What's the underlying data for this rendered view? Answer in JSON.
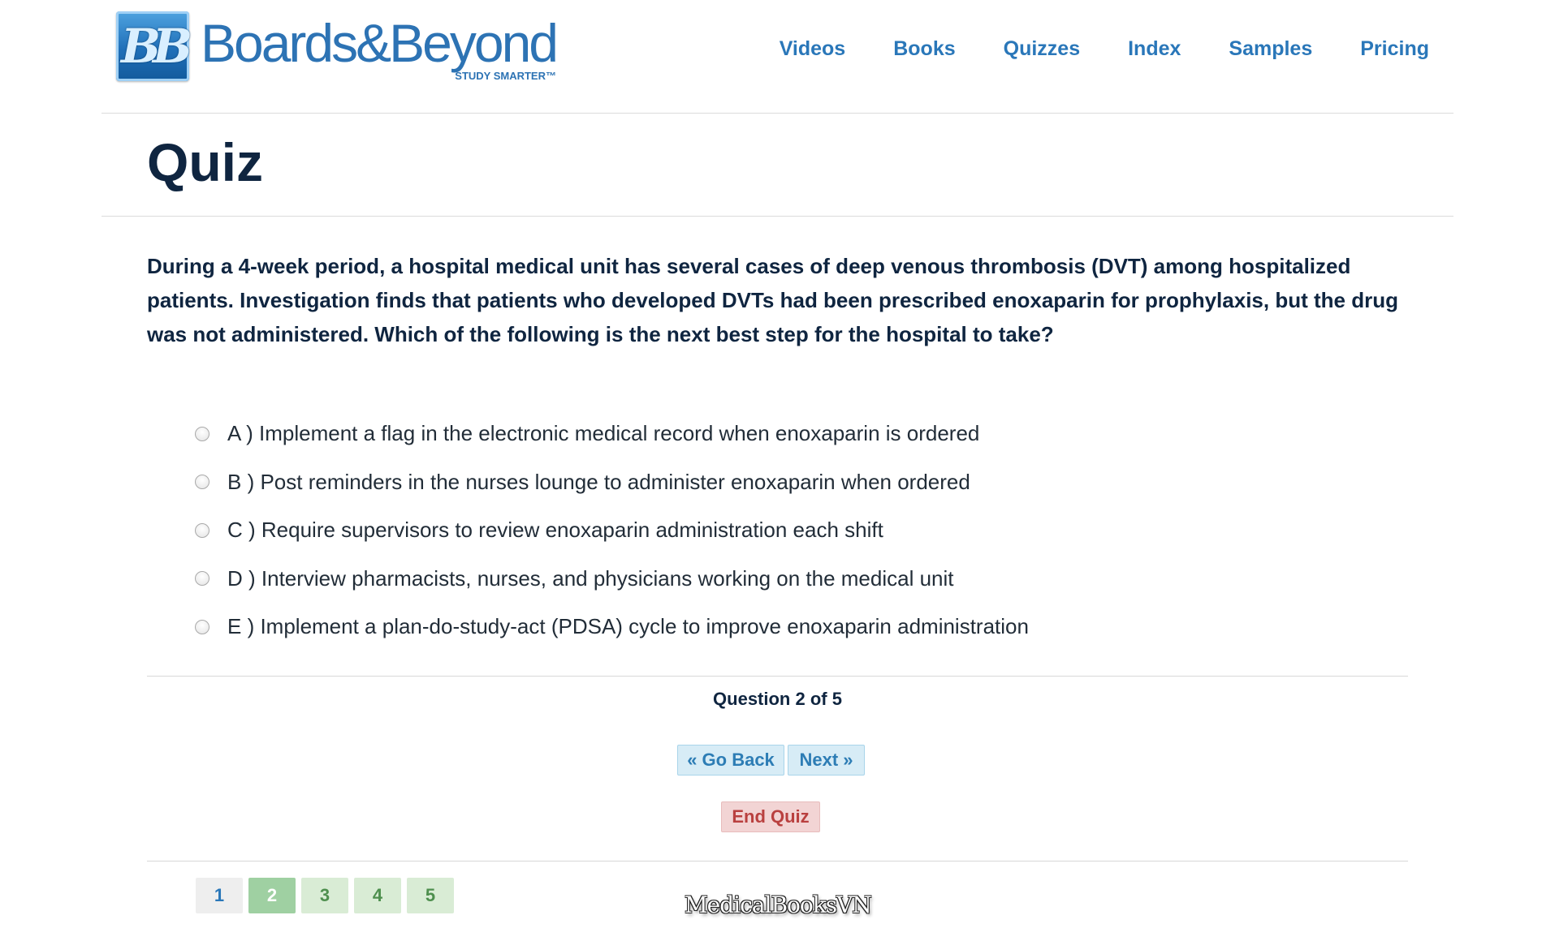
{
  "header": {
    "logo_mark": "BB",
    "logo_name": "Boards&Beyond",
    "logo_registered": "®",
    "logo_tagline": "STUDY SMARTER™",
    "nav": [
      "Videos",
      "Books",
      "Quizzes",
      "Index",
      "Samples",
      "Pricing"
    ]
  },
  "page_title": "Quiz",
  "question": {
    "text": "During a 4-week period, a hospital medical unit has several cases of deep venous thrombosis (DVT) among hospitalized patients. Investigation finds that patients who developed DVTs had been prescribed enoxaparin for prophylaxis, but the drug was not administered. Which of the following is the next best step for the hospital to take?",
    "options": [
      "A ) Implement a flag in the electronic medical record when enoxaparin is ordered",
      "B ) Post reminders in the nurses lounge to administer enoxaparin when ordered",
      "C ) Require supervisors to review enoxaparin administration each shift",
      "D ) Interview pharmacists, nurses, and physicians working on the medical unit",
      "E ) Implement a plan-do-study-act (PDSA) cycle to improve enoxaparin administration"
    ]
  },
  "progress": "Question 2 of 5",
  "buttons": {
    "back": "« Go Back",
    "next": "Next »",
    "end": "End Quiz"
  },
  "pager": [
    "1",
    "2",
    "3",
    "4",
    "5"
  ],
  "pager_current": 2,
  "watermark": "MedicalBooksVN",
  "colors": {
    "nav_link": "#2a77b9",
    "title": "#0f2540",
    "nav_button_bg": "#d7ecf6",
    "end_button_bg": "#f2d4d4",
    "current_page_bg": "#9fd0a2"
  }
}
